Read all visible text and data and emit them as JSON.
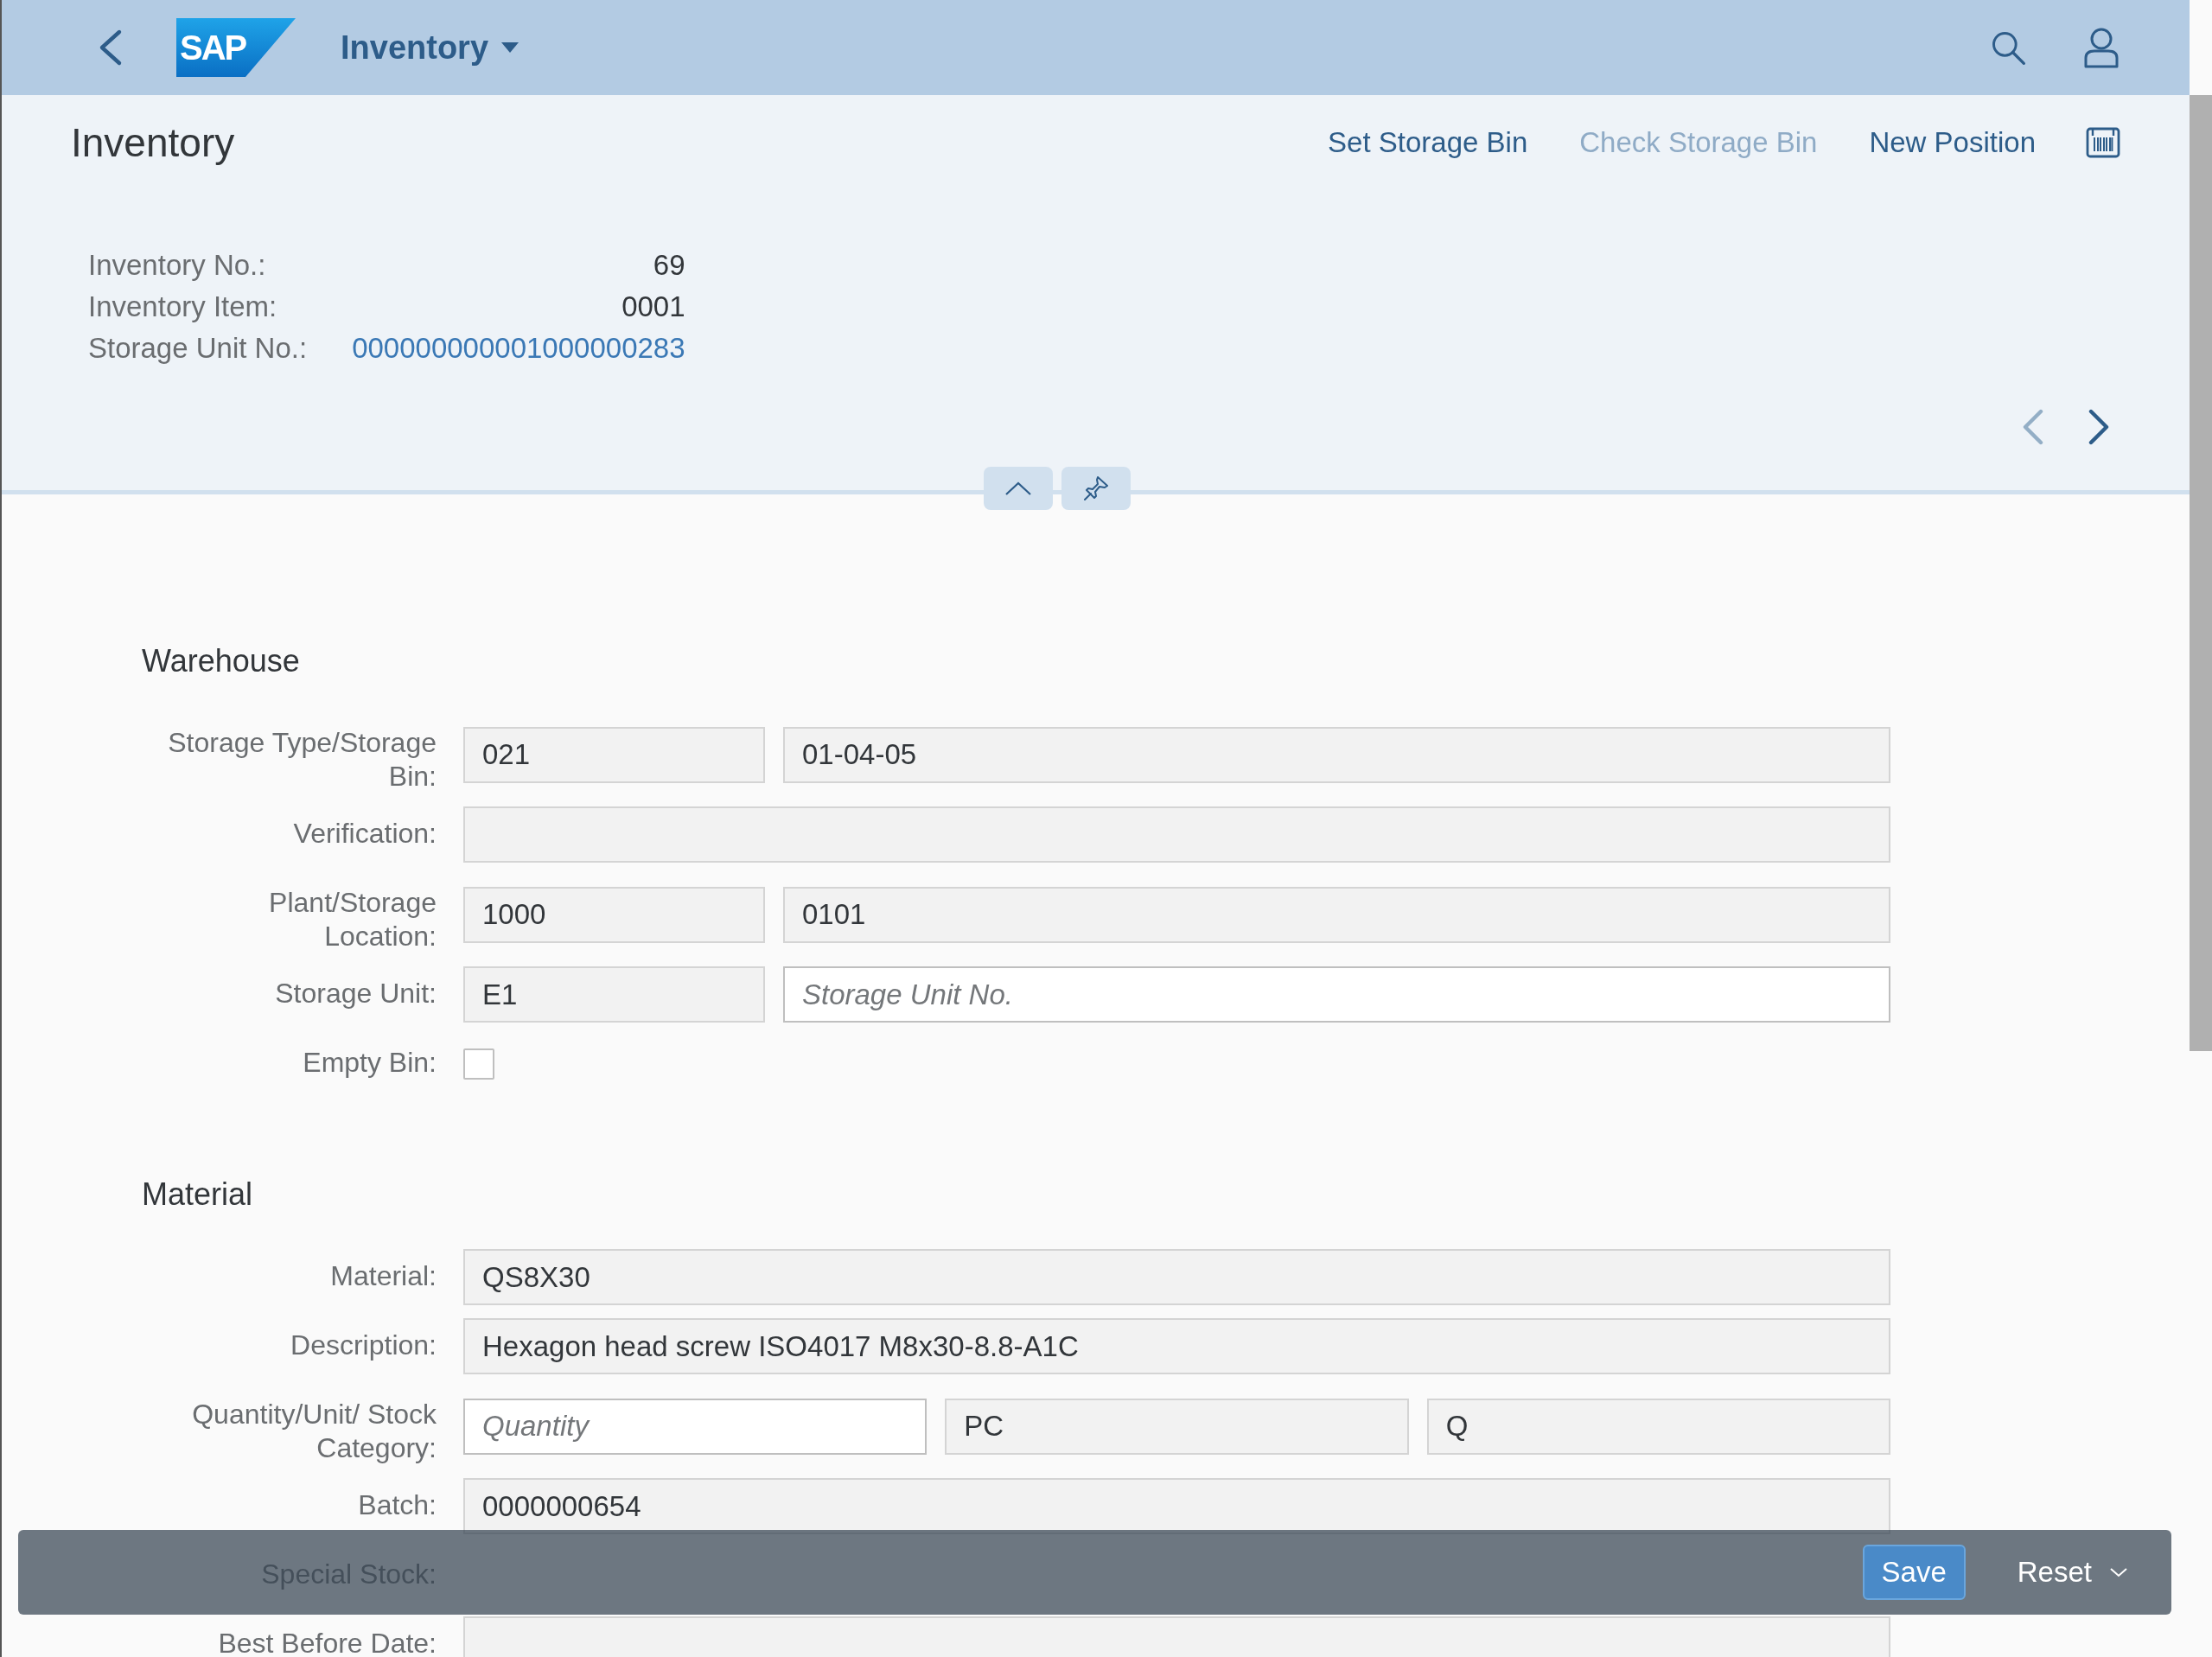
{
  "shell": {
    "logo": "SAP",
    "app_title": "Inventory"
  },
  "header": {
    "title": "Inventory",
    "actions": [
      {
        "label": "Set Storage Bin",
        "disabled": false
      },
      {
        "label": "Check Storage Bin",
        "disabled": true
      },
      {
        "label": "New Position",
        "disabled": false
      }
    ],
    "attributes": [
      {
        "label": "Inventory No.:",
        "value": "69",
        "kind": "text"
      },
      {
        "label": "Inventory Item:",
        "value": "0001",
        "kind": "text"
      },
      {
        "label": "Storage Unit No.:",
        "value": "000000000001000000283",
        "kind": "link"
      }
    ],
    "navigation": {
      "previous_disabled": true,
      "next_disabled": false
    }
  },
  "sections": [
    {
      "title": "Warehouse",
      "rows": [
        {
          "label": "Storage Type/Storage Bin:",
          "kind": "fields",
          "fields": [
            {
              "value": "021",
              "editable": false
            },
            {
              "value": "01-04-05",
              "editable": false
            }
          ]
        },
        {
          "label": "Verification:",
          "kind": "fields",
          "fields": [
            {
              "editable": false
            }
          ]
        },
        {
          "label": "Plant/Storage Location:",
          "kind": "fields",
          "fields": [
            {
              "value": "1000",
              "editable": false
            },
            {
              "value": "0101",
              "editable": false
            }
          ]
        },
        {
          "label": "Storage Unit:",
          "kind": "fields",
          "fields": [
            {
              "value": "E1",
              "editable": false
            },
            {
              "placeholder": "Storage Unit No.",
              "editable": true
            }
          ]
        },
        {
          "label": "Empty Bin:",
          "kind": "checkbox",
          "checked": false
        }
      ]
    },
    {
      "title": "Material",
      "rows": [
        {
          "label": "Material:",
          "kind": "fields",
          "fields": [
            {
              "value": "QS8X30",
              "editable": false
            }
          ]
        },
        {
          "label": "Description:",
          "kind": "fields",
          "fields": [
            {
              "value": "Hexagon head screw ISO4017 M8x30-8.8-A1C",
              "editable": false
            }
          ]
        },
        {
          "label": "Quantity/Unit/ Stock Category:",
          "kind": "fields",
          "fields": [
            {
              "placeholder": "Quantity",
              "editable": true
            },
            {
              "value": "PC",
              "editable": false
            },
            {
              "value": "Q",
              "editable": false
            }
          ]
        },
        {
          "label": "Batch:",
          "kind": "fields",
          "fields": [
            {
              "value": "0000000654",
              "editable": false
            }
          ]
        },
        {
          "label": "Special Stock:",
          "kind": "label"
        },
        {
          "label": "Best Before Date:",
          "kind": "fields",
          "fields": [
            {
              "editable": false
            }
          ]
        }
      ]
    }
  ],
  "footer": {
    "buttons": [
      {
        "label": "Save",
        "kind": "emphasized"
      },
      {
        "label": "Reset",
        "kind": "menu"
      }
    ]
  }
}
